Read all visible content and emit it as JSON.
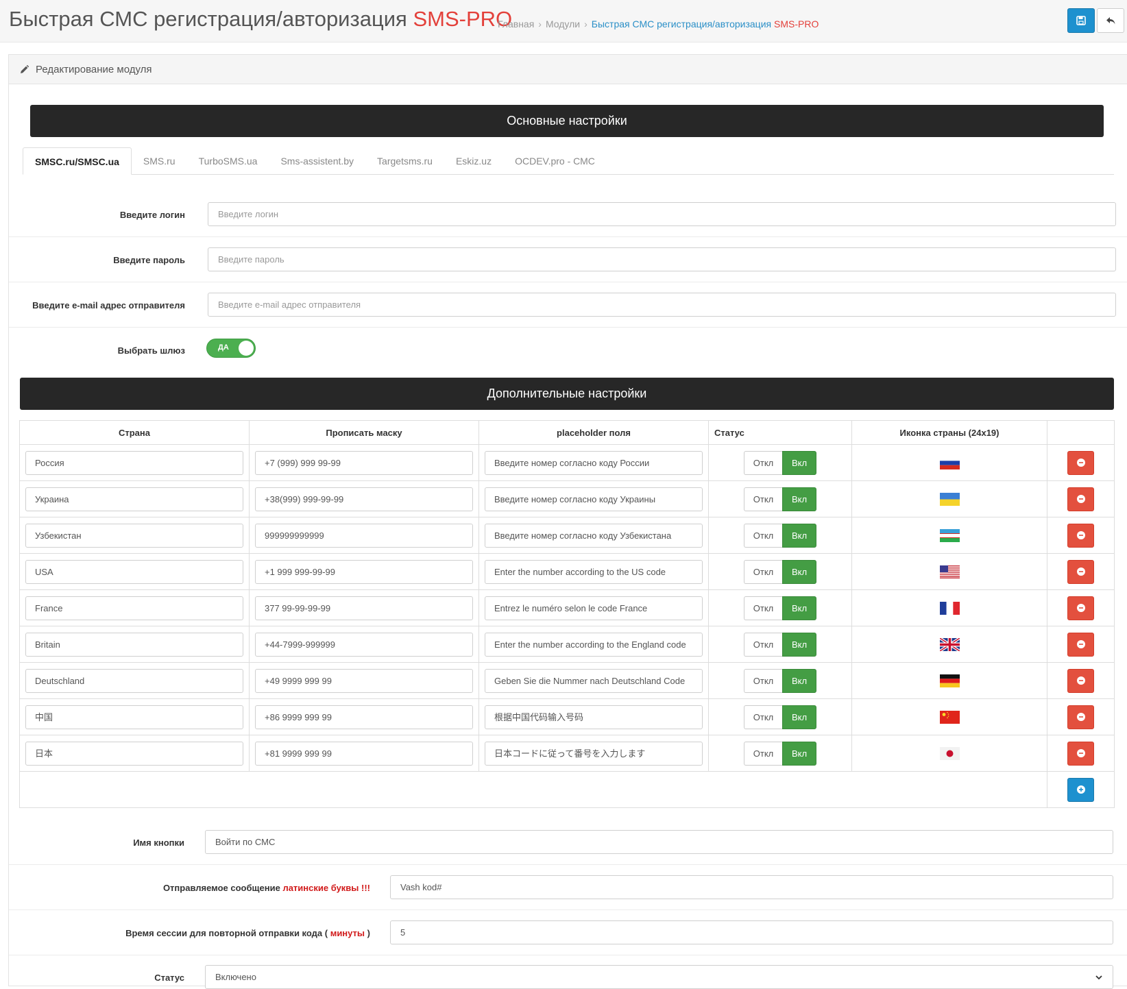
{
  "header": {
    "title_main": "Быстрая СМС регистрация/авторизация",
    "title_accent": "SMS-PRO",
    "breadcrumb": {
      "home": "Главная",
      "modules": "Модули",
      "current_main": "Быстрая СМС регистрация/авторизация",
      "current_accent": "SMS-PRO"
    },
    "icons": {
      "save": "save-icon",
      "back": "reply-icon"
    }
  },
  "panel": {
    "heading": "Редактирование модуля",
    "main_settings_title": "Основные настройки",
    "extra_settings_title": "Дополнительные настройки"
  },
  "tabs": [
    {
      "label": "SMSC.ru/SMSC.ua",
      "active": true
    },
    {
      "label": "SMS.ru"
    },
    {
      "label": "TurboSMS.ua"
    },
    {
      "label": "Sms-assistent.by"
    },
    {
      "label": "Targetsms.ru"
    },
    {
      "label": "Eskiz.uz"
    },
    {
      "label": "OCDEV.pro - СМС"
    }
  ],
  "gateway_form": {
    "login_label": "Введите логин",
    "login_placeholder": "Введите логин",
    "password_label": "Введите пароль",
    "password_placeholder": "Введите пароль",
    "email_label": "Введите e-mail адрес отправителя",
    "email_placeholder": "Введите e-mail адрес отправителя",
    "gateway_label": "Выбрать шлюз",
    "gateway_toggle": "ДА"
  },
  "countries_table": {
    "headers": {
      "country": "Страна",
      "mask": "Прописать маску",
      "placeholder": "placeholder поля",
      "status": "Статус",
      "icon": "Иконка страны (24x19)"
    },
    "status_off": "Откл",
    "status_on": "Вкл",
    "rows": [
      {
        "country": "Россия",
        "mask": "+7 (999) 999 99-99",
        "placeholder": "Введите номер согласно коду России",
        "flag": "ru"
      },
      {
        "country": "Украина",
        "mask": "+38(999) 999-99-99",
        "placeholder": "Введите номер согласно коду Украины",
        "flag": "ua"
      },
      {
        "country": "Узбекистан",
        "mask": "999999999999",
        "placeholder": "Введите номер согласно коду Узбекистана",
        "flag": "uz"
      },
      {
        "country": "USA",
        "mask": "+1 999 999-99-99",
        "placeholder": "Enter the number according to the US code",
        "flag": "us"
      },
      {
        "country": "France",
        "mask": "377 99-99-99-99",
        "placeholder": "Entrez le numéro selon le code France",
        "flag": "fr"
      },
      {
        "country": "Britain",
        "mask": "+44-7999-999999",
        "placeholder": "Enter the number according to the England code",
        "flag": "gb"
      },
      {
        "country": "Deutschland",
        "mask": "+49 9999 999 99",
        "placeholder": "Geben Sie die Nummer nach Deutschland Code",
        "flag": "de"
      },
      {
        "country": "中国",
        "mask": "+86 9999 999 99",
        "placeholder": "根据中国代码输入号码",
        "flag": "cn"
      },
      {
        "country": "日本",
        "mask": "+81 9999 999 99",
        "placeholder": "日本コードに従って番号を入力します",
        "flag": "jp"
      }
    ]
  },
  "extra_form": {
    "button_name_label": "Имя кнопки",
    "button_name_value": "Войти по СМС",
    "message_label": "Отправляемое сообщение",
    "message_label_red": "латинские буквы !!!",
    "message_value": "Vash kod#",
    "session_label_a": "Время сессии для повторной отправки кода (",
    "session_label_red": "минуты",
    "session_label_b": ")",
    "session_value": "5",
    "status_label": "Статус",
    "status_value": "Включено"
  },
  "colors": {
    "accent_red": "#e3403a",
    "primary_blue": "#1e91cf",
    "success_green": "#449d44",
    "danger_red": "#e3503e",
    "dark_bar": "#272727"
  }
}
